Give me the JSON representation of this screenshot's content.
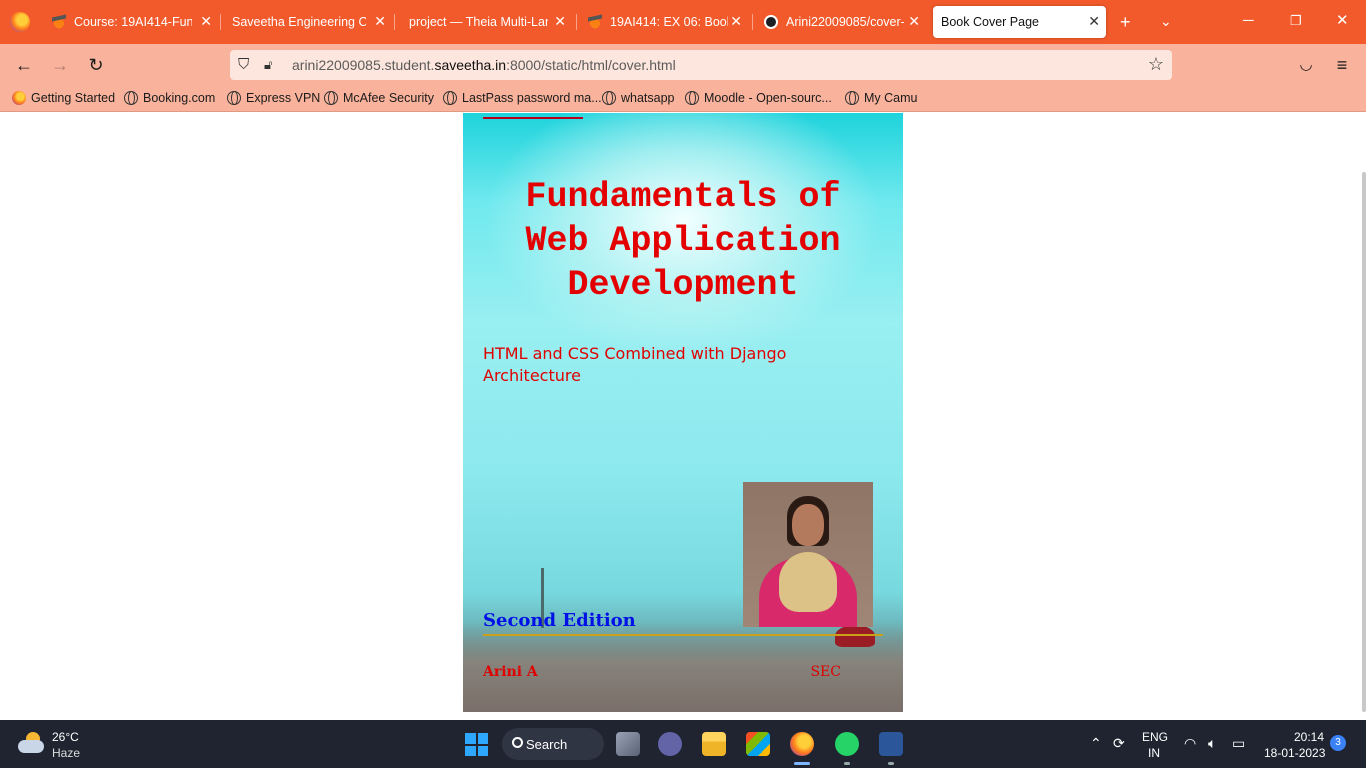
{
  "browser": {
    "tabs": [
      {
        "label": "Course: 19AI414-Funda",
        "favicon": "moodle-icon"
      },
      {
        "label": "Saveetha Engineering Colle",
        "favicon": "none"
      },
      {
        "label": "project — Theia Multi-Lang",
        "favicon": "none"
      },
      {
        "label": "19AI414: EX 06: Book C",
        "favicon": "moodle-icon"
      },
      {
        "label": "Arini22009085/cover-p",
        "favicon": "github-icon"
      },
      {
        "label": "Book Cover Page",
        "favicon": "none",
        "active": true
      }
    ],
    "url": {
      "prefix": "arini22009085.student.",
      "domain": "saveetha.in",
      "suffix": ":8000/static/html/cover.html"
    },
    "bookmarks": [
      {
        "label": "Getting Started",
        "icon": "firefox-icon"
      },
      {
        "label": "Booking.com",
        "icon": "globe-icon"
      },
      {
        "label": "Express VPN",
        "icon": "globe-icon"
      },
      {
        "label": "McAfee Security",
        "icon": "globe-icon"
      },
      {
        "label": "LastPass password ma...",
        "icon": "globe-icon"
      },
      {
        "label": "whatsapp",
        "icon": "globe-icon"
      },
      {
        "label": "Moodle - Open-sourc...",
        "icon": "globe-icon"
      },
      {
        "label": "My Camu",
        "icon": "globe-icon"
      }
    ],
    "accent_color": "#f25a2b",
    "toolbar_color": "#f9b39c"
  },
  "cover": {
    "title_lines": [
      "Fundamentals of",
      "Web Application",
      "Development"
    ],
    "subtitle_lines": [
      "HTML and CSS Combined with Django",
      "Architecture"
    ],
    "edition": "Second Edition",
    "author": "Arini A",
    "college": "SEC",
    "title_color": "#e40000",
    "edition_color": "#0010e6"
  },
  "taskbar": {
    "weather_temp": "26°C",
    "weather_condition": "Haze",
    "search_label": "Search",
    "language_top": "ENG",
    "language_bottom": "IN",
    "time": "20:14",
    "date": "18-01-2023",
    "notification_count": "3"
  }
}
